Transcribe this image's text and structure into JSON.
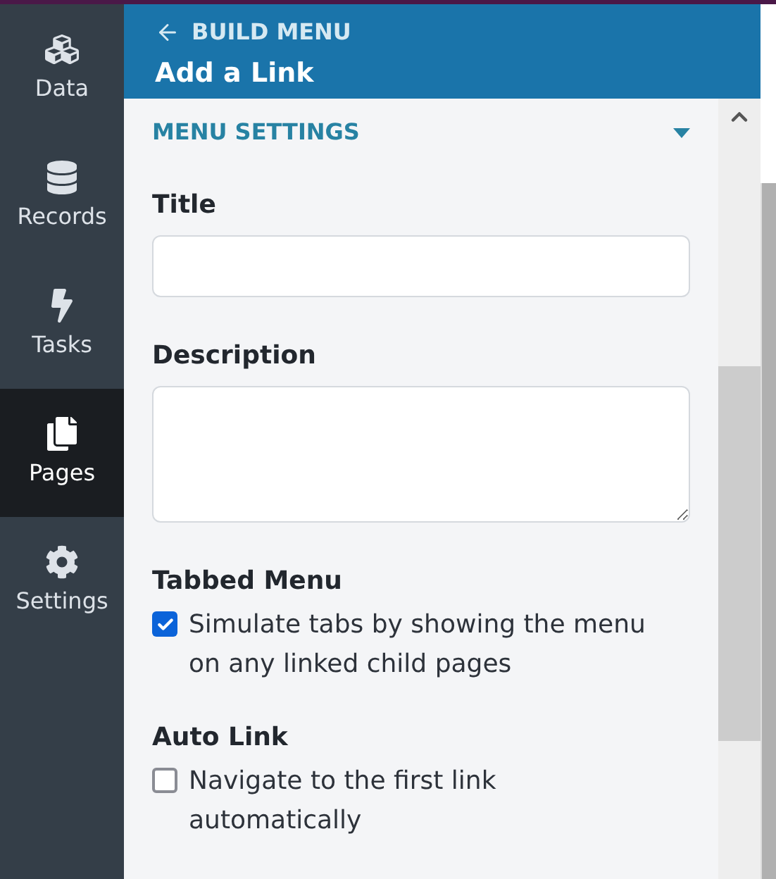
{
  "sidebar": {
    "items": [
      {
        "kind": "data",
        "label": "Data",
        "selected": false
      },
      {
        "kind": "records",
        "label": "Records",
        "selected": false
      },
      {
        "kind": "tasks",
        "label": "Tasks",
        "selected": false
      },
      {
        "kind": "pages",
        "label": "Pages",
        "selected": true
      },
      {
        "kind": "settings",
        "label": "Settings",
        "selected": false
      }
    ]
  },
  "header": {
    "back_link": "BUILD MENU",
    "title": "Add a Link"
  },
  "section": {
    "title": "MENU SETTINGS",
    "expanded": true
  },
  "fields": [
    {
      "kind": "input",
      "label": "Title"
    },
    {
      "kind": "textarea",
      "label": "Description"
    },
    {
      "kind": "checkbox",
      "label": "Tabbed Menu",
      "option": "Simulate tabs by showing the menu on any linked child pages",
      "checked": true
    },
    {
      "kind": "checkbox",
      "label": "Auto Link",
      "option": "Navigate to the first link automatically",
      "checked": false
    }
  ]
}
